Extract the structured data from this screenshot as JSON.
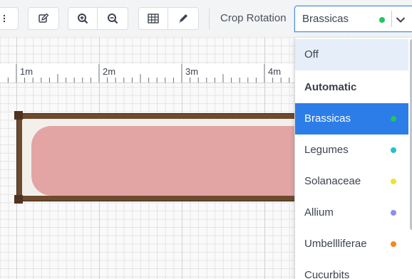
{
  "toolbar": {
    "crop_rotation_label": "Crop Rotation",
    "crop_rotation_value": "Brassicas",
    "crop_rotation_dot_color": "#22c55e",
    "icons": [
      "first-tool-icon",
      "edit-icon",
      "zoom-in-icon",
      "zoom-out-icon",
      "grid-icon",
      "pencil-icon"
    ]
  },
  "ruler": {
    "labels": [
      "1m",
      "2m",
      "3m",
      "4m"
    ]
  },
  "menu": {
    "items": [
      {
        "label": "Off",
        "dot": null,
        "state": "hover"
      },
      {
        "label": "Automatic",
        "dot": null,
        "state": "normal"
      },
      {
        "label": "Brassicas",
        "dot": "#22c55e",
        "state": "selected"
      },
      {
        "label": "Legumes",
        "dot": "#22c3c9",
        "state": "normal"
      },
      {
        "label": "Solanaceae",
        "dot": "#efe22a",
        "state": "normal"
      },
      {
        "label": "Allium",
        "dot": "#8c8ee9",
        "state": "normal"
      },
      {
        "label": "Umbellliferae",
        "dot": "#ef8b20",
        "state": "normal"
      },
      {
        "label": "Cucurbits",
        "dot": null,
        "state": "partial"
      }
    ]
  },
  "colors": {
    "accent": "#2d7de9",
    "bed_wood": "#6e4a2e",
    "bed_planting": "#d67878"
  }
}
